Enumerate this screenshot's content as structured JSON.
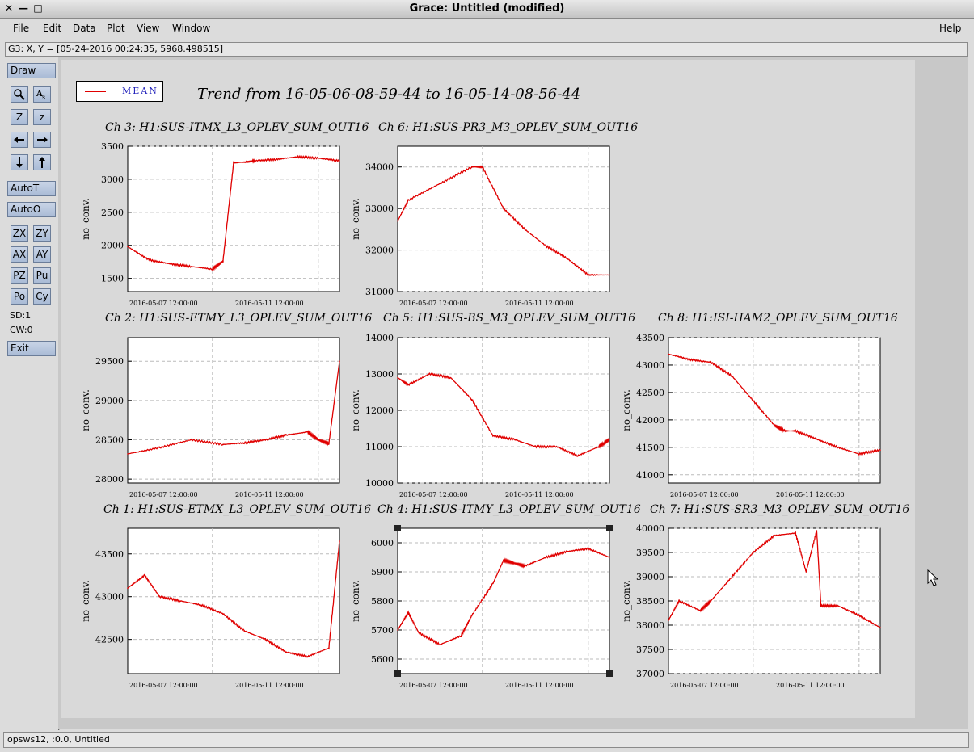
{
  "window": {
    "title": "Grace: Untitled (modified)",
    "close_glyph": "✕",
    "minimize_glyph": "—",
    "maximize_glyph": "□"
  },
  "menubar": {
    "items": [
      "File",
      "Edit",
      "Data",
      "Plot",
      "View",
      "Window"
    ],
    "help": "Help"
  },
  "coord_readout": "G3: X, Y = [05-24-2016 00:24:35, 5968.498515]",
  "toolbar": {
    "draw": "Draw",
    "autot": "AutoT",
    "autoo": "AutoO",
    "zx": "ZX",
    "zy": "ZY",
    "ax": "AX",
    "ay": "AY",
    "pz": "PZ",
    "pu": "Pu",
    "po": "Po",
    "cy": "Cy",
    "sd": "SD:1",
    "cw": "CW:0",
    "exit": "Exit",
    "icon_labels": {
      "zoom_z_big": "Z",
      "zoom_z_small": "z"
    }
  },
  "statusbar": "opsws12, :0.0, Untitled",
  "legend": {
    "label": "MEAN",
    "color": "#e00000"
  },
  "main_title": "Trend from 16-05-06-08-59-44 to 16-05-14-08-56-44",
  "line_color": "#e00000",
  "chart_data": [
    {
      "type": "line",
      "title": "Ch 3: H1:SUS-ITMX_L3_OPLEV_SUM_OUT16",
      "ylabel": "no_conv.",
      "xticks": [
        "2016-05-07 12:00:00",
        "2016-05-11 12:00:00"
      ],
      "yticks": [
        1500,
        2000,
        2500,
        3000,
        3500
      ],
      "ylim": [
        1300,
        3500
      ],
      "x": [
        0,
        0.1,
        0.2,
        0.3,
        0.4,
        0.45,
        0.5,
        0.56,
        0.6,
        0.7,
        0.8,
        0.9,
        1.0
      ],
      "y": [
        1980,
        1780,
        1720,
        1680,
        1640,
        1760,
        3250,
        3260,
        3280,
        3300,
        3340,
        3320,
        3280
      ],
      "legend": "none",
      "grid": true
    },
    {
      "type": "line",
      "title": "Ch 6: H1:SUS-PR3_M3_OPLEV_SUM_OUT16",
      "ylabel": "no_conv.",
      "xticks": [
        "2016-05-07 12:00:00",
        "2016-05-11 12:00:00"
      ],
      "yticks": [
        31000,
        32000,
        33000,
        34000
      ],
      "ylim": [
        31000,
        34500
      ],
      "x": [
        0,
        0.05,
        0.2,
        0.35,
        0.4,
        0.5,
        0.6,
        0.7,
        0.8,
        0.9,
        1.0
      ],
      "y": [
        32700,
        33200,
        33600,
        34000,
        34000,
        33000,
        32500,
        32100,
        31800,
        31400,
        31400
      ],
      "legend": "none",
      "grid": true
    },
    {
      "type": "line",
      "title": "Ch 2: H1:SUS-ETMY_L3_OPLEV_SUM_OUT16",
      "ylabel": "no_conv.",
      "xticks": [
        "2016-05-07 12:00:00",
        "2016-05-11 12:00:00"
      ],
      "yticks": [
        28000,
        28500,
        29000,
        29500
      ],
      "ylim": [
        27950,
        29800
      ],
      "x": [
        0,
        0.15,
        0.3,
        0.45,
        0.55,
        0.65,
        0.75,
        0.85,
        0.9,
        0.95,
        1.0
      ],
      "y": [
        28320,
        28400,
        28500,
        28440,
        28460,
        28500,
        28560,
        28600,
        28500,
        28450,
        29500
      ],
      "legend": "none",
      "grid": true
    },
    {
      "type": "line",
      "title": "Ch 5: H1:SUS-BS_M3_OPLEV_SUM_OUT16",
      "ylabel": "no_conv.",
      "xticks": [
        "2016-05-07 12:00:00",
        "2016-05-11 12:00:00"
      ],
      "yticks": [
        10000,
        11000,
        12000,
        13000,
        14000
      ],
      "ylim": [
        10000,
        14000
      ],
      "x": [
        0,
        0.05,
        0.15,
        0.25,
        0.35,
        0.45,
        0.55,
        0.65,
        0.75,
        0.85,
        0.95,
        1.0
      ],
      "y": [
        12900,
        12700,
        13000,
        12900,
        12300,
        11300,
        11200,
        11000,
        11000,
        10750,
        11000,
        11200
      ],
      "legend": "none",
      "grid": true
    },
    {
      "type": "line",
      "title": "Ch 8: H1:ISI-HAM2_OPLEV_SUM_OUT16",
      "ylabel": "no_conv.",
      "xticks": [
        "2016-05-07 12:00:00",
        "2016-05-11 12:00:00"
      ],
      "yticks": [
        41000,
        41500,
        42000,
        42500,
        43000,
        43500
      ],
      "ylim": [
        40850,
        43500
      ],
      "x": [
        0,
        0.1,
        0.2,
        0.3,
        0.4,
        0.5,
        0.55,
        0.6,
        0.7,
        0.8,
        0.9,
        1.0
      ],
      "y": [
        43200,
        43100,
        43050,
        42800,
        42350,
        41900,
        41800,
        41800,
        41650,
        41500,
        41380,
        41450
      ],
      "legend": "none",
      "grid": true
    },
    {
      "type": "line",
      "title": "Ch 1: H1:SUS-ETMX_L3_OPLEV_SUM_OUT16",
      "ylabel": "no_conv.",
      "xticks": [
        "2016-05-07 12:00:00",
        "2016-05-11 12:00:00"
      ],
      "yticks": [
        42500,
        43000,
        43500
      ],
      "ylim": [
        42100,
        43800
      ],
      "x": [
        0,
        0.08,
        0.15,
        0.25,
        0.35,
        0.45,
        0.55,
        0.65,
        0.75,
        0.85,
        0.95,
        1.0
      ],
      "y": [
        43100,
        43250,
        43000,
        42950,
        42900,
        42800,
        42600,
        42500,
        42350,
        42300,
        42400,
        43650
      ],
      "legend": "none",
      "grid": true
    },
    {
      "type": "line",
      "title": "Ch 4: H1:SUS-ITMY_L3_OPLEV_SUM_OUT16",
      "ylabel": "no_conv.",
      "xticks": [
        "2016-05-07 12:00:00",
        "2016-05-11 12:00:00"
      ],
      "yticks": [
        5600,
        5700,
        5800,
        5900,
        6000
      ],
      "ylim": [
        5550,
        6050
      ],
      "x": [
        0,
        0.05,
        0.1,
        0.2,
        0.3,
        0.35,
        0.45,
        0.5,
        0.55,
        0.6,
        0.7,
        0.8,
        0.9,
        1.0
      ],
      "y": [
        5700,
        5760,
        5690,
        5650,
        5680,
        5750,
        5860,
        5940,
        5930,
        5920,
        5950,
        5970,
        5980,
        5950
      ],
      "legend": "none",
      "grid": true
    },
    {
      "type": "line",
      "title": "Ch 7: H1:SUS-SR3_M3_OPLEV_SUM_OUT16",
      "ylabel": "no_conv.",
      "xticks": [
        "2016-05-07 12:00:00",
        "2016-05-11 12:00:00"
      ],
      "yticks": [
        37000,
        37500,
        38000,
        38500,
        39000,
        39500,
        40000
      ],
      "ylim": [
        37000,
        40000
      ],
      "x": [
        0,
        0.05,
        0.15,
        0.2,
        0.3,
        0.4,
        0.5,
        0.6,
        0.65,
        0.7,
        0.72,
        0.8,
        0.9,
        1.0
      ],
      "y": [
        38100,
        38500,
        38300,
        38500,
        39000,
        39500,
        39850,
        39900,
        39100,
        39950,
        38400,
        38400,
        38200,
        37950
      ],
      "legend": "none",
      "grid": true
    }
  ]
}
